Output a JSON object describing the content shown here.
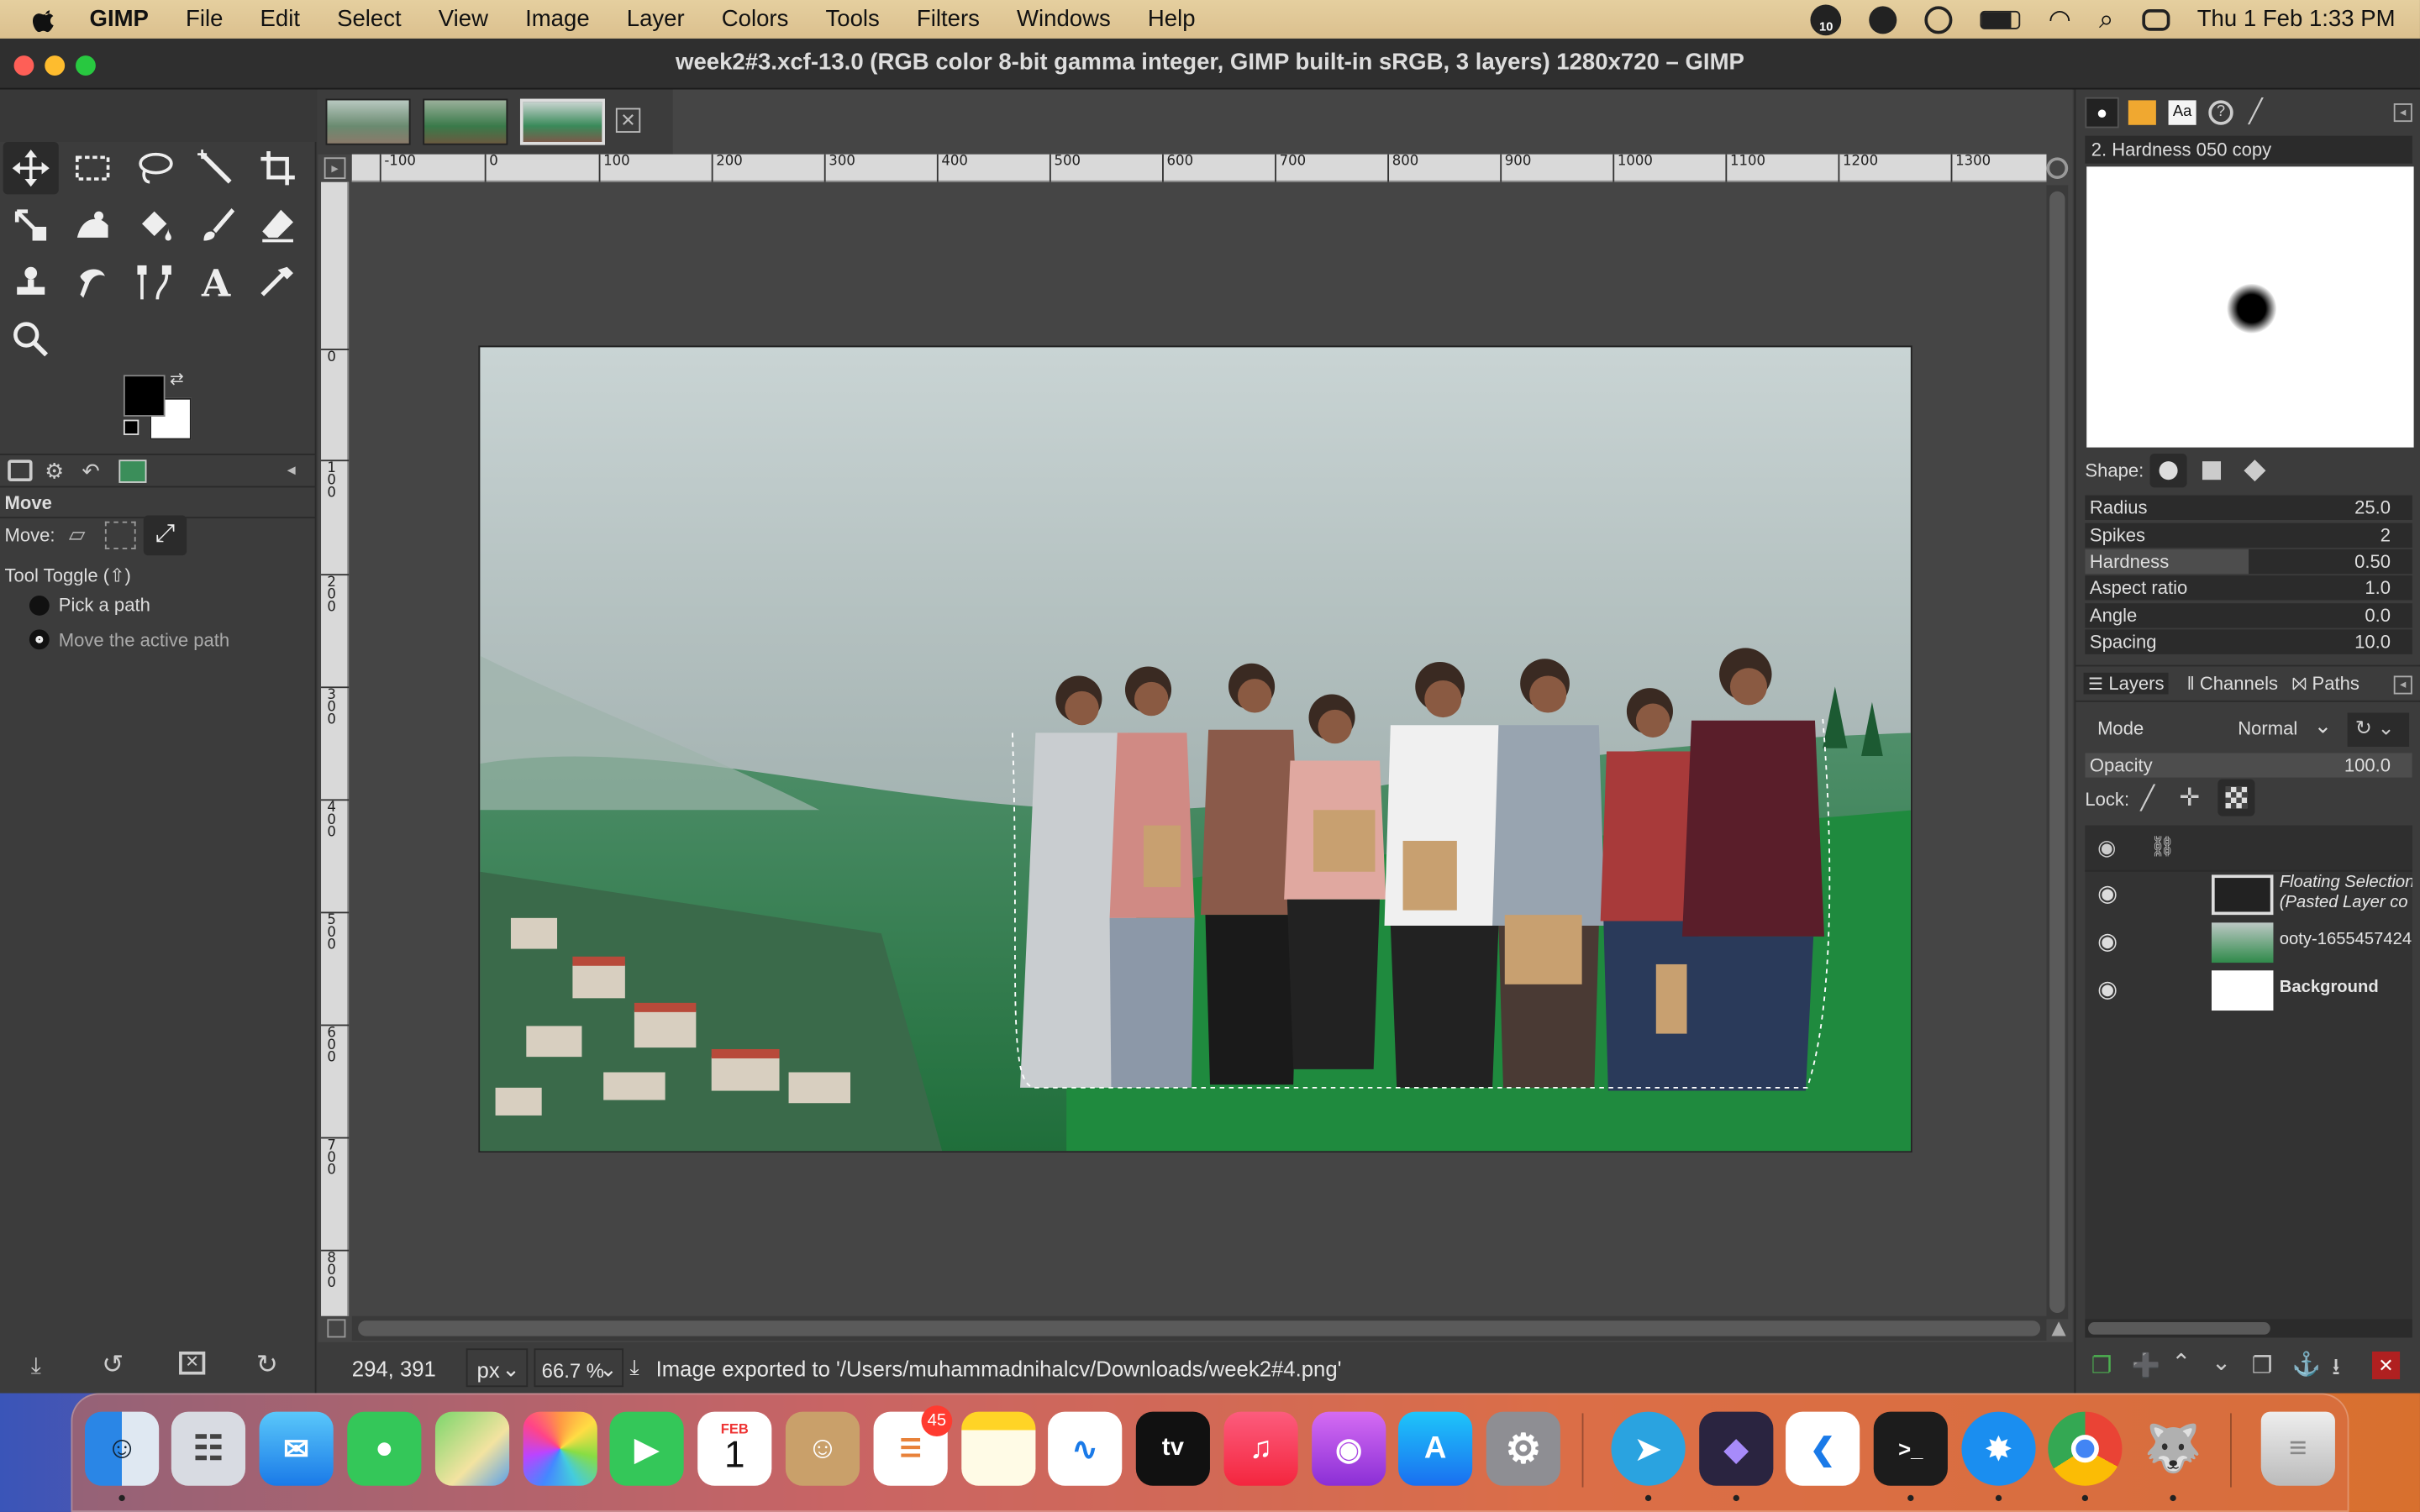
{
  "menubar": {
    "app": "GIMP",
    "items": [
      "File",
      "Edit",
      "Select",
      "View",
      "Image",
      "Layer",
      "Colors",
      "Tools",
      "Filters",
      "Windows",
      "Help"
    ],
    "badge": "10",
    "datetime": "Thu 1 Feb  1:33 PM"
  },
  "window": {
    "title": "week2#3.xcf-13.0 (RGB color 8-bit gamma integer, GIMP built-in sRGB, 3 layers) 1280x720 – GIMP"
  },
  "tool_options": {
    "title": "Move",
    "move_label": "Move:",
    "toggle_label": "Tool Toggle  (⇧)",
    "radio1": "Pick a path",
    "radio2": "Move the active path"
  },
  "rulers": {
    "h": [
      "-100",
      "0",
      "100",
      "200",
      "300",
      "400",
      "500",
      "600",
      "700",
      "800",
      "900",
      "1000",
      "1100",
      "1200",
      "1300"
    ],
    "v": [
      "0",
      "1\n0\n0",
      "2\n0\n0",
      "3\n0\n0",
      "4\n0\n0",
      "5\n0\n0",
      "6\n0\n0",
      "7\n0\n0",
      "8\n0\n0"
    ]
  },
  "status": {
    "coords": "294, 391",
    "unit": "px",
    "zoom": "66.7 %",
    "message": "Image exported to '/Users/muhammadnihalcv/Downloads/week2#4.png'"
  },
  "brushes": {
    "name": "2. Hardness 050 copy",
    "shape_label": "Shape:",
    "params": [
      {
        "name": "Radius",
        "value": "25.0",
        "fill": 0.0
      },
      {
        "name": "Spikes",
        "value": "2",
        "fill": 0.0
      },
      {
        "name": "Hardness",
        "value": "0.50",
        "fill": 0.5
      },
      {
        "name": "Aspect ratio",
        "value": "1.0",
        "fill": 0.0
      },
      {
        "name": "Angle",
        "value": "0.0",
        "fill": 0.0
      },
      {
        "name": "Spacing",
        "value": "10.0",
        "fill": 0.0
      }
    ]
  },
  "layers_panel": {
    "tabs": [
      "Layers",
      "Channels",
      "Paths"
    ],
    "mode_label": "Mode",
    "mode_value": "Normal",
    "opacity_label": "Opacity",
    "opacity_value": "100.0",
    "lock_label": "Lock:",
    "layers": [
      {
        "name": "Floating Selection\n(Pasted Layer co",
        "italic": true
      },
      {
        "name": "ooty-1655457424",
        "italic": false
      },
      {
        "name": "Background",
        "italic": false
      }
    ]
  },
  "dock": {
    "calendar_month": "FEB",
    "calendar_day": "1",
    "reminders_badge": "45",
    "apps": [
      "Finder",
      "Launchpad",
      "Mail",
      "Messages",
      "Maps",
      "Photos",
      "FaceTime",
      "Calendar",
      "Contacts",
      "Reminders",
      "Notes",
      "Freeform",
      "Apple TV",
      "Music",
      "Podcasts",
      "App Store",
      "System Settings",
      "Telegram",
      "Obsidian",
      "VS Code",
      "Terminal",
      "Safari",
      "Chrome",
      "GIMP",
      "Trash"
    ]
  },
  "colors": {
    "accent": "#1e7fd8",
    "menubar": "#e0c896",
    "panel": "#3c3c3c",
    "canvas": "#454545"
  }
}
